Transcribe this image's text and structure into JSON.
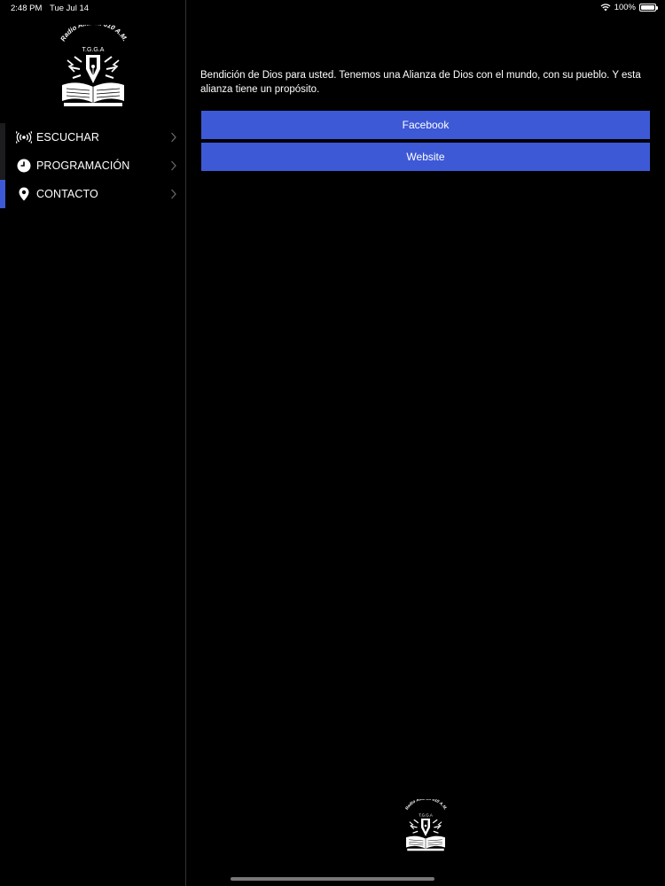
{
  "status_bar": {
    "time": "2:48 PM",
    "date": "Tue Jul 14",
    "battery": "100%"
  },
  "logo": {
    "text": "Radio Alianza 610 A.M.",
    "subtext": "T.G.G.A"
  },
  "sidebar": {
    "items": [
      {
        "label": "ESCUCHAR",
        "icon": "broadcast-icon",
        "active": false
      },
      {
        "label": "PROGRAMACIÓN",
        "icon": "clock-icon",
        "active": false
      },
      {
        "label": "CONTACTO",
        "icon": "location-pin-icon",
        "active": true
      }
    ]
  },
  "main": {
    "intro": "Bendición de Dios para usted. Tenemos una Alianza de Dios con el mundo, con su pueblo. Y esta alianza tiene un propósito.",
    "buttons": {
      "facebook": "Facebook",
      "website": "Website"
    }
  },
  "colors": {
    "accent": "#3d59d6",
    "background": "#000000",
    "divider": "#333333"
  }
}
